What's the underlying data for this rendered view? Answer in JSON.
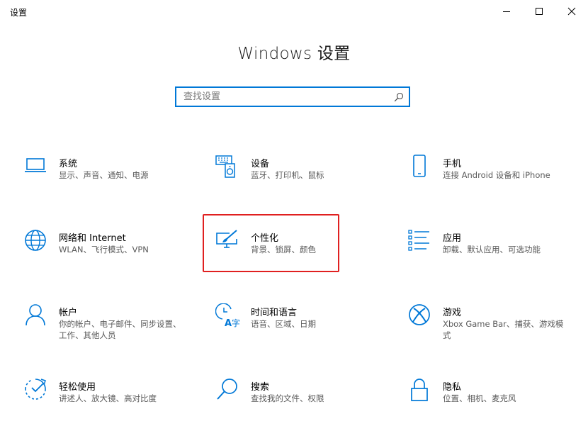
{
  "window": {
    "title": "设置",
    "controls": {
      "minimize": "minimize",
      "maximize": "maximize",
      "close": "close"
    }
  },
  "page": {
    "title": "Windows 设置"
  },
  "search": {
    "placeholder": "查找设置",
    "value": ""
  },
  "accent": "#0078d7",
  "highlight_color": "#e02020",
  "tiles": [
    {
      "name": "系统",
      "desc": "显示、声音、通知、电源",
      "icon": "laptop-icon"
    },
    {
      "name": "设备",
      "desc": "蓝牙、打印机、鼠标",
      "icon": "devices-icon"
    },
    {
      "name": "手机",
      "desc": "连接 Android 设备和 iPhone",
      "icon": "phone-icon"
    },
    {
      "name": "网络和 Internet",
      "desc": "WLAN、飞行模式、VPN",
      "icon": "globe-icon"
    },
    {
      "name": "个性化",
      "desc": "背景、锁屏、颜色",
      "icon": "personalization-icon"
    },
    {
      "name": "应用",
      "desc": "卸载、默认应用、可选功能",
      "icon": "apps-list-icon"
    },
    {
      "name": "帐户",
      "desc": "你的帐户、电子邮件、同步设置、工作、其他人员",
      "icon": "person-icon"
    },
    {
      "name": "时间和语言",
      "desc": "语音、区域、日期",
      "icon": "time-language-icon"
    },
    {
      "name": "游戏",
      "desc": "Xbox Game Bar、捕获、游戏模式",
      "icon": "xbox-icon"
    },
    {
      "name": "轻松使用",
      "desc": "讲述人、放大镜、高对比度",
      "icon": "ease-of-access-icon"
    },
    {
      "name": "搜索",
      "desc": "查找我的文件、权限",
      "icon": "search-icon"
    },
    {
      "name": "隐私",
      "desc": "位置、相机、麦克风",
      "icon": "lock-icon"
    }
  ]
}
